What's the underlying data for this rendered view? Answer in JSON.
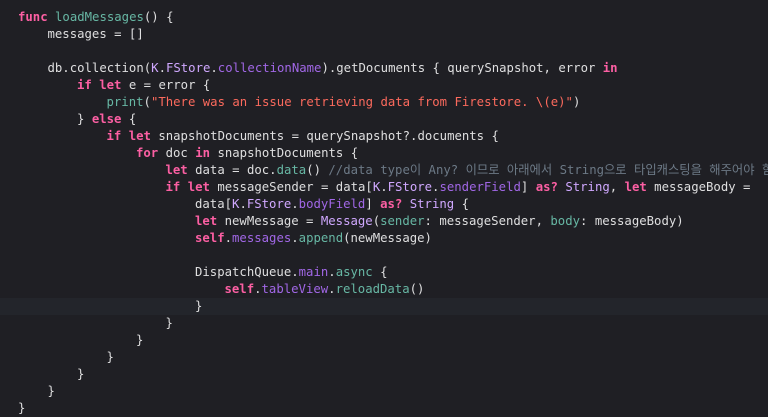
{
  "editor": {
    "language": "Swift",
    "colors": {
      "background": "#1f1f24",
      "current_line": "#23252b",
      "keyword": "#fc5fa3",
      "function": "#67b7a4",
      "property": "#a167e6",
      "type": "#d0a8ff",
      "string": "#fc6a5d",
      "comment": "#6c7986",
      "plain": "#dfdfe0"
    },
    "lines": [
      {
        "indent": 0,
        "tokens": [
          [
            "kw",
            "func"
          ],
          [
            "pl",
            " "
          ],
          [
            "fn",
            "loadMessages"
          ],
          [
            "pl",
            "() {"
          ]
        ]
      },
      {
        "indent": 1,
        "tokens": [
          [
            "pl",
            "messages = []"
          ]
        ]
      },
      {
        "indent": 0,
        "tokens": []
      },
      {
        "indent": 1,
        "tokens": [
          [
            "pl",
            "db.collection("
          ],
          [
            "ty",
            "K"
          ],
          [
            "pl",
            "."
          ],
          [
            "ty",
            "FStore"
          ],
          [
            "pl",
            "."
          ],
          [
            "pr",
            "collectionName"
          ],
          [
            "pl",
            ").getDocuments { querySnapshot, error "
          ],
          [
            "kw",
            "in"
          ]
        ]
      },
      {
        "indent": 2,
        "tokens": [
          [
            "kw",
            "if"
          ],
          [
            "pl",
            " "
          ],
          [
            "kw",
            "let"
          ],
          [
            "pl",
            " e = error {"
          ]
        ]
      },
      {
        "indent": 3,
        "tokens": [
          [
            "fn",
            "print"
          ],
          [
            "pl",
            "("
          ],
          [
            "str",
            "\"There was an issue retrieving data from Firestore. \\(e)\""
          ],
          [
            "pl",
            ")"
          ]
        ]
      },
      {
        "indent": 2,
        "tokens": [
          [
            "pl",
            "} "
          ],
          [
            "kw",
            "else"
          ],
          [
            "pl",
            " {"
          ]
        ]
      },
      {
        "indent": 3,
        "tokens": [
          [
            "kw",
            "if"
          ],
          [
            "pl",
            " "
          ],
          [
            "kw",
            "let"
          ],
          [
            "pl",
            " snapshotDocuments = querySnapshot?.documents {"
          ]
        ]
      },
      {
        "indent": 4,
        "tokens": [
          [
            "kw",
            "for"
          ],
          [
            "pl",
            " doc "
          ],
          [
            "kw",
            "in"
          ],
          [
            "pl",
            " snapshotDocuments {"
          ]
        ]
      },
      {
        "indent": 5,
        "tokens": [
          [
            "kw",
            "let"
          ],
          [
            "pl",
            " data = doc."
          ],
          [
            "fn",
            "data"
          ],
          [
            "pl",
            "() "
          ],
          [
            "cm",
            "//data type이 Any? 이므로 아래에서 String으로 타입캐스팅을 해주어야 함"
          ]
        ]
      },
      {
        "indent": 5,
        "tokens": [
          [
            "kw",
            "if"
          ],
          [
            "pl",
            " "
          ],
          [
            "kw",
            "let"
          ],
          [
            "pl",
            " messageSender = data["
          ],
          [
            "ty",
            "K"
          ],
          [
            "pl",
            "."
          ],
          [
            "ty",
            "FStore"
          ],
          [
            "pl",
            "."
          ],
          [
            "pr",
            "senderField"
          ],
          [
            "pl",
            "] "
          ],
          [
            "kw",
            "as?"
          ],
          [
            "pl",
            " "
          ],
          [
            "ty",
            "String"
          ],
          [
            "pl",
            ", "
          ],
          [
            "kw",
            "let"
          ],
          [
            "pl",
            " messageBody ="
          ]
        ]
      },
      {
        "indent": 6,
        "tokens": [
          [
            "pl",
            "data["
          ],
          [
            "ty",
            "K"
          ],
          [
            "pl",
            "."
          ],
          [
            "ty",
            "FStore"
          ],
          [
            "pl",
            "."
          ],
          [
            "pr",
            "bodyField"
          ],
          [
            "pl",
            "] "
          ],
          [
            "kw",
            "as?"
          ],
          [
            "pl",
            " "
          ],
          [
            "ty",
            "String"
          ],
          [
            "pl",
            " {"
          ]
        ]
      },
      {
        "indent": 6,
        "tokens": [
          [
            "kw",
            "let"
          ],
          [
            "pl",
            " newMessage = "
          ],
          [
            "ty",
            "Message"
          ],
          [
            "pl",
            "("
          ],
          [
            "fn",
            "sender"
          ],
          [
            "pl",
            ": messageSender, "
          ],
          [
            "fn",
            "body"
          ],
          [
            "pl",
            ": messageBody)"
          ]
        ]
      },
      {
        "indent": 6,
        "tokens": [
          [
            "kw",
            "self"
          ],
          [
            "pl",
            "."
          ],
          [
            "pr",
            "messages"
          ],
          [
            "pl",
            "."
          ],
          [
            "fn",
            "append"
          ],
          [
            "pl",
            "(newMessage)"
          ]
        ]
      },
      {
        "indent": 0,
        "tokens": []
      },
      {
        "indent": 6,
        "tokens": [
          [
            "pl",
            "DispatchQueue."
          ],
          [
            "pr",
            "main"
          ],
          [
            "pl",
            "."
          ],
          [
            "fn",
            "async"
          ],
          [
            "pl",
            " {"
          ]
        ]
      },
      {
        "indent": 7,
        "tokens": [
          [
            "kw",
            "self"
          ],
          [
            "pl",
            "."
          ],
          [
            "pr",
            "tableView"
          ],
          [
            "pl",
            "."
          ],
          [
            "fn",
            "reloadData"
          ],
          [
            "pl",
            "()"
          ]
        ]
      },
      {
        "indent": 6,
        "tokens": [
          [
            "pl",
            "}"
          ]
        ],
        "current": true
      },
      {
        "indent": 5,
        "tokens": [
          [
            "pl",
            "}"
          ]
        ]
      },
      {
        "indent": 4,
        "tokens": [
          [
            "pl",
            "}"
          ]
        ]
      },
      {
        "indent": 3,
        "tokens": [
          [
            "pl",
            "}"
          ]
        ]
      },
      {
        "indent": 2,
        "tokens": [
          [
            "pl",
            "}"
          ]
        ]
      },
      {
        "indent": 1,
        "tokens": [
          [
            "pl",
            "}"
          ]
        ]
      },
      {
        "indent": 0,
        "tokens": [
          [
            "pl",
            "}"
          ]
        ]
      }
    ]
  }
}
